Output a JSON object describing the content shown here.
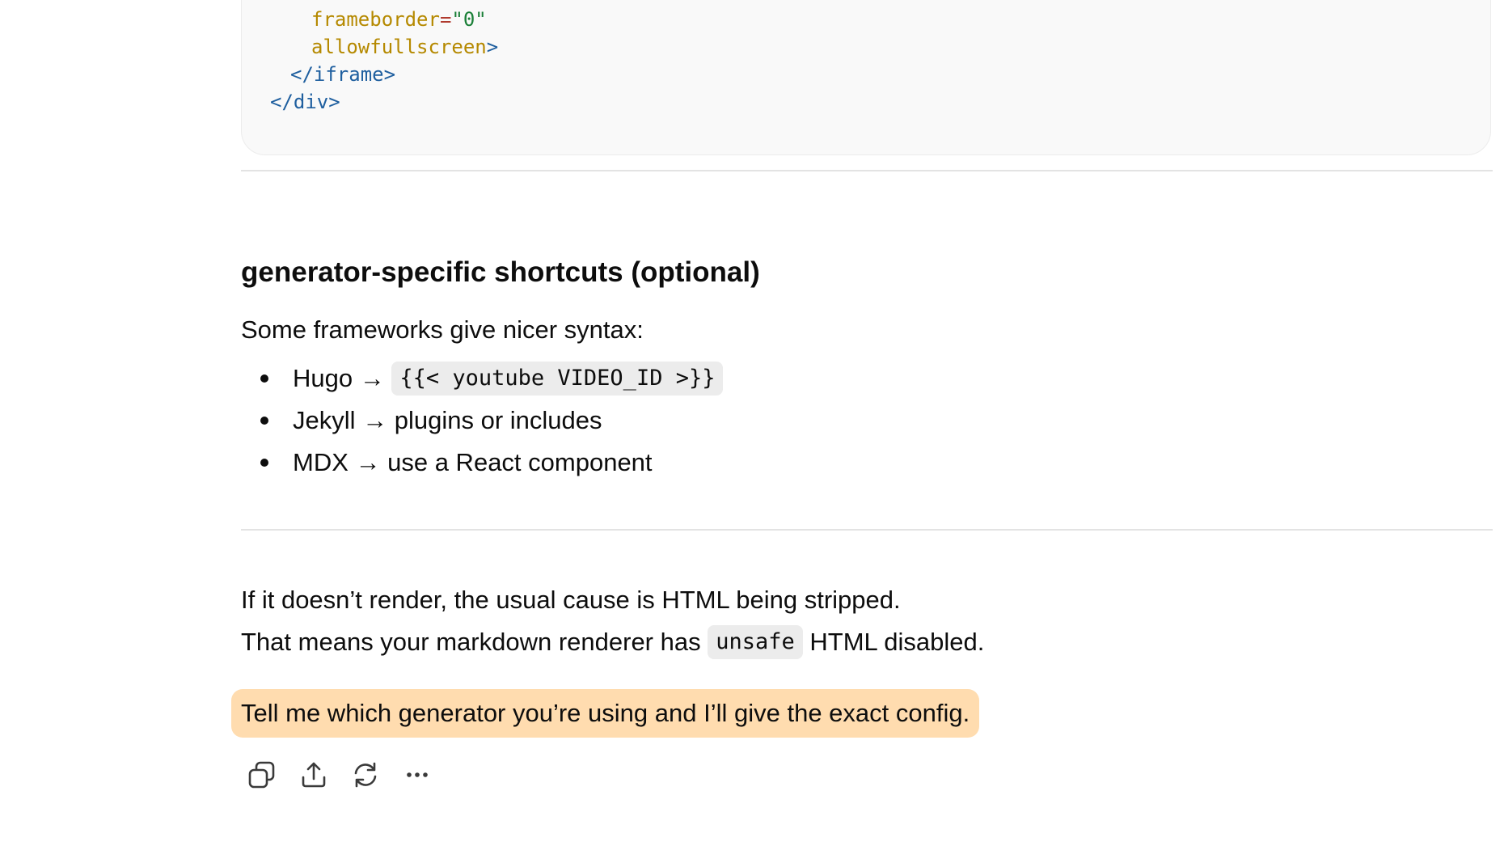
{
  "code": {
    "lines": [
      {
        "attr": "frameborder",
        "eq": "=",
        "str": "\"0\""
      },
      {
        "attr": "allowfullscreen",
        "tag_close": ">"
      },
      {
        "tag": "</iframe>"
      },
      {
        "tag": "</div>"
      }
    ]
  },
  "section": {
    "heading": "generator-specific shortcuts (optional)",
    "intro": "Some frameworks give nicer syntax:",
    "bullets": [
      {
        "prefix": "Hugo → ",
        "code": "{{< youtube VIDEO_ID >}}",
        "suffix": ""
      },
      {
        "prefix": "Jekyll → plugins or includes",
        "code": "",
        "suffix": ""
      },
      {
        "prefix": "MDX → use a React component",
        "code": "",
        "suffix": ""
      }
    ]
  },
  "footer_text": {
    "line1": "If it doesn’t render, the usual cause is HTML being stripped.",
    "line2_prefix": "That means your markdown renderer has ",
    "line2_code": "unsafe",
    "line2_suffix": " HTML disabled.",
    "highlight": "Tell me which generator you’re using and I’ll give the exact config."
  },
  "actions": {
    "icons": [
      "copy-icon",
      "share-icon",
      "regenerate-icon",
      "more-icon"
    ]
  },
  "colors": {
    "highlight_bg": "#ffdcaf",
    "code_bg": "#f9f9f9",
    "inline_code_bg": "#ececec",
    "attr": "#b58900",
    "string": "#1a7f37",
    "tag": "#1f5f9f"
  }
}
